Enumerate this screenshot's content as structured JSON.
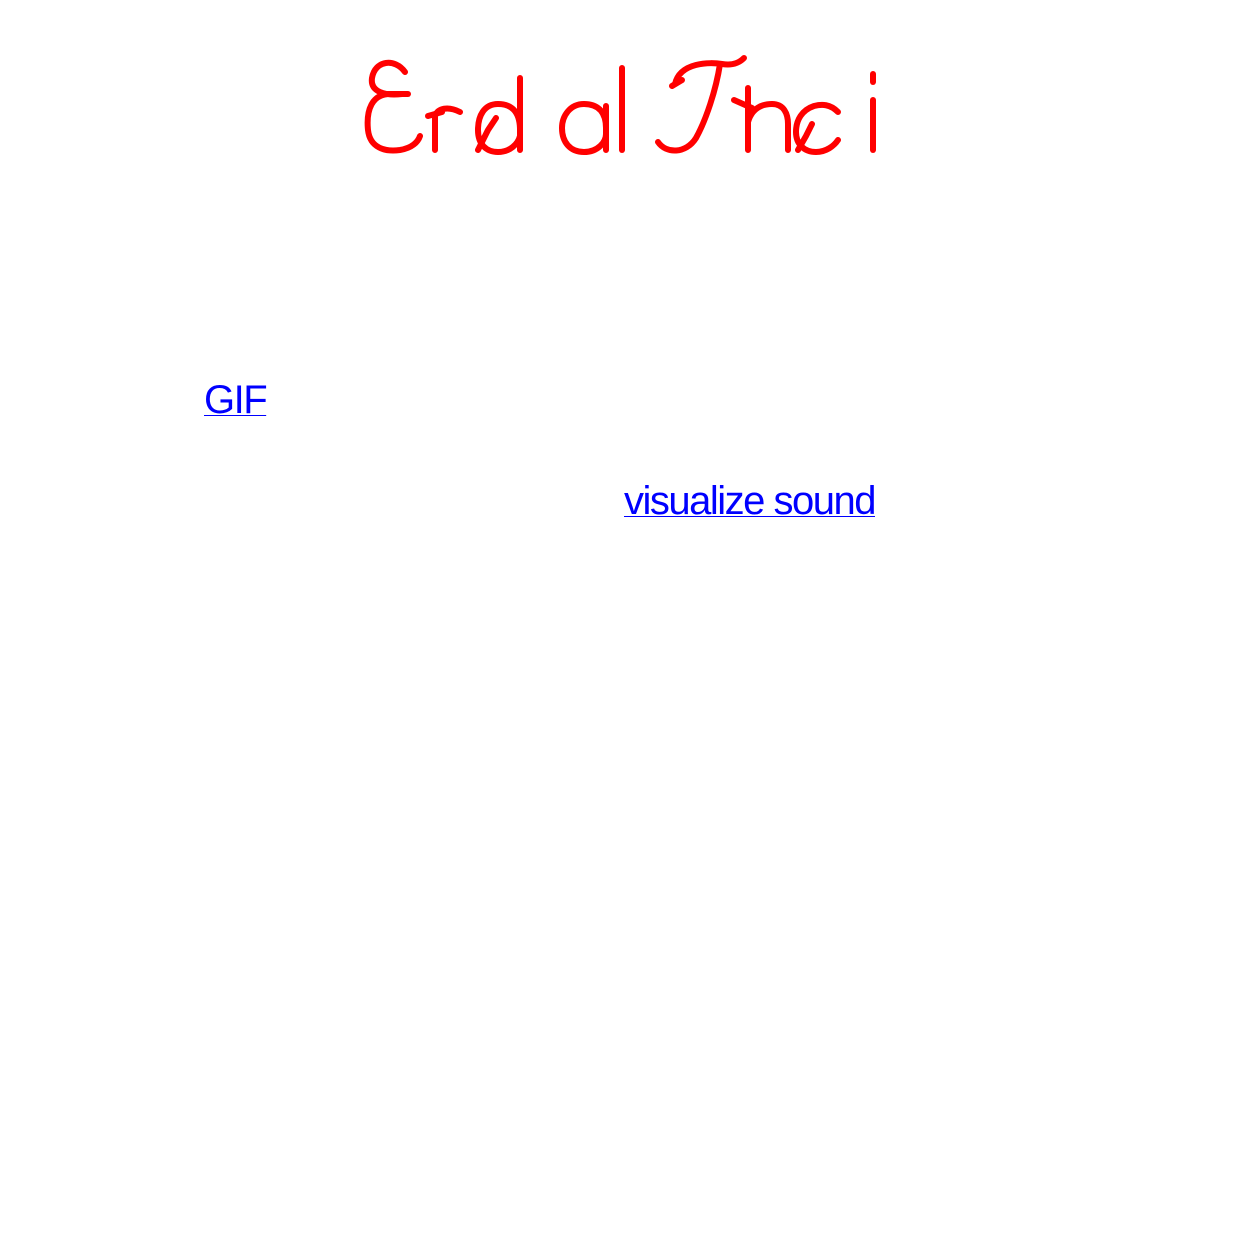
{
  "header": {
    "logo_text": "Erdal Inci",
    "logo_color": "#ff0000"
  },
  "links": {
    "color": "#0000ff",
    "gif_label": "GIF",
    "sound_label": "visualize sound"
  }
}
